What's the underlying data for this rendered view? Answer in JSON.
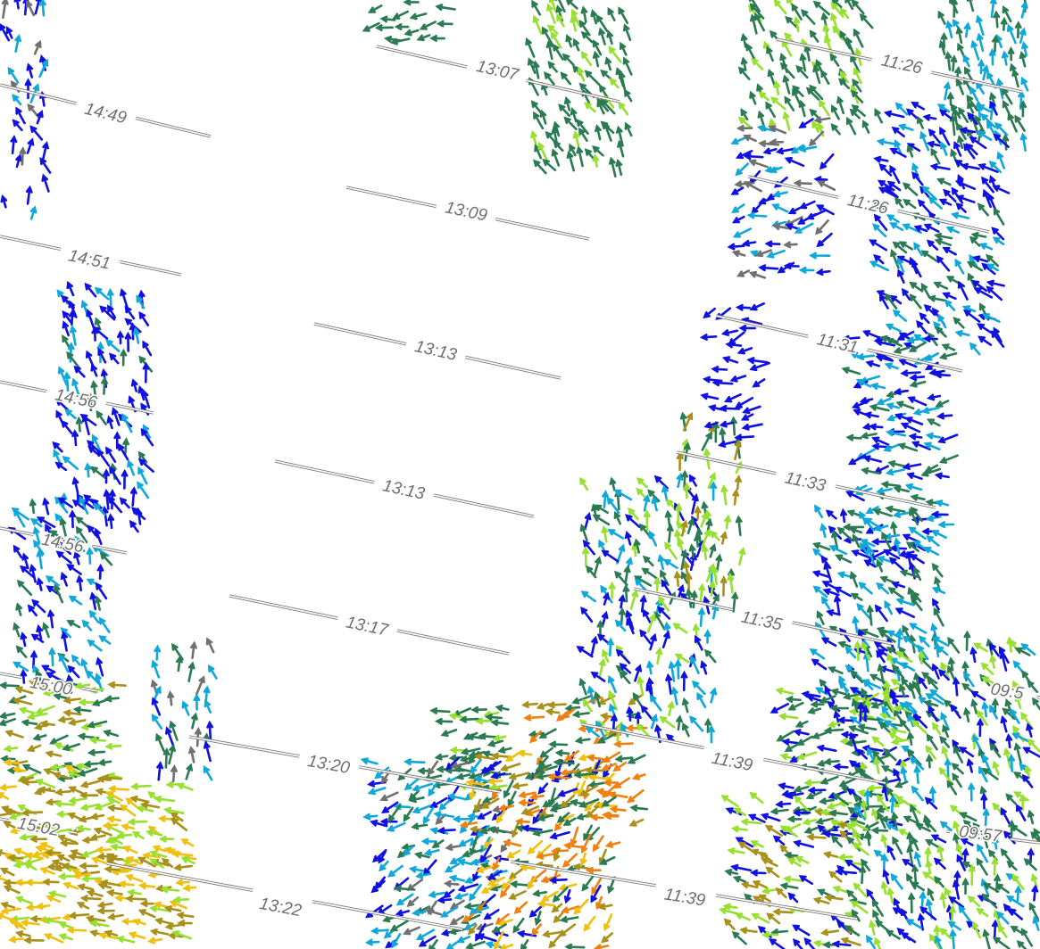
{
  "map": {
    "palette": {
      "blue": "#1010e0",
      "cyan": "#10a8d8",
      "dark_green": "#2a7a52",
      "light_green": "#98e030",
      "olive": "#a8901a",
      "yellow": "#f0c010",
      "orange": "#f08010",
      "gray": "#707070",
      "track_outline": "#7a7a7a",
      "label": "#6e6e6e"
    },
    "track_labels": [
      "14:49",
      "14:51",
      "14:56",
      "14:56",
      "15:00",
      "15:02",
      "13:07",
      "13:09",
      "13:13",
      "13:13",
      "13:17",
      "13:20",
      "13:22",
      "11:26",
      "11:26",
      "11:31",
      "11:33",
      "11:35",
      "11:39",
      "11:39",
      "09:5",
      "09:57"
    ]
  }
}
